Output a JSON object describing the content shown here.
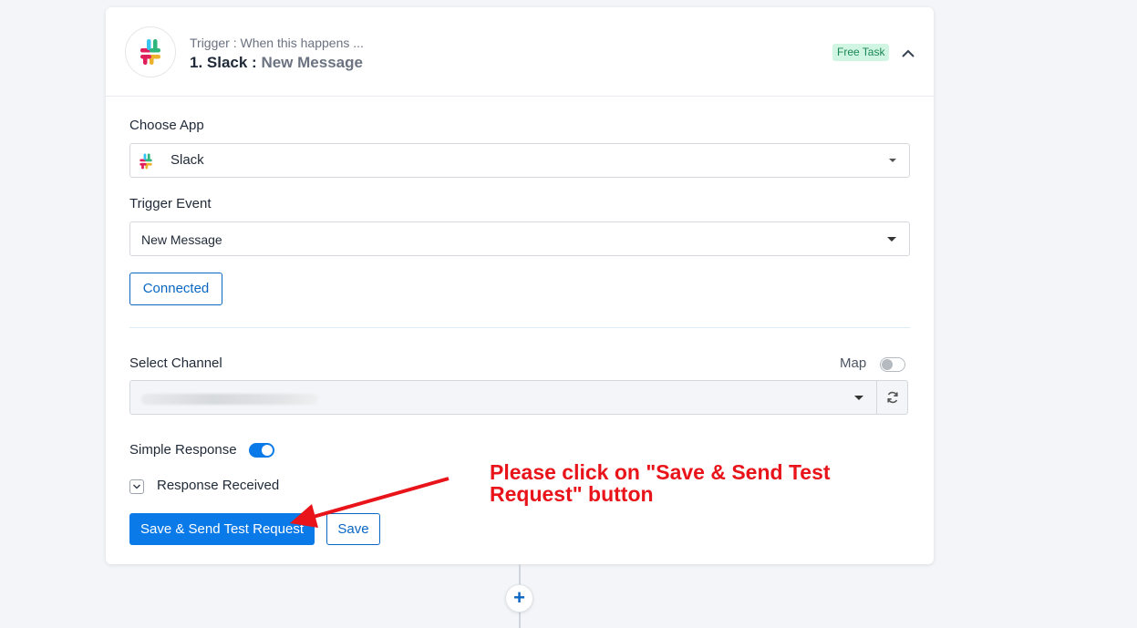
{
  "header": {
    "trigger_subtitle": "Trigger : When this happens ...",
    "step_prefix": "1. Slack :",
    "step_event": "New Message",
    "badge": "Free Task",
    "collapse_icon": "chevron-up-icon",
    "app_icon": "slack-logo-icon"
  },
  "form": {
    "choose_app_label": "Choose App",
    "choose_app_value": "Slack",
    "trigger_event_label": "Trigger Event",
    "trigger_event_value": "New Message",
    "connected_label": "Connected",
    "select_channel_label": "Select Channel",
    "map_label": "Map",
    "map_enabled": false,
    "refresh_icon": "refresh-icon",
    "simple_response_label": "Simple Response",
    "simple_response_enabled": true,
    "response_received_label": "Response Received",
    "save_send_label": "Save & Send Test Request",
    "save_label": "Save"
  },
  "annotation": {
    "text": "Please click on \"Save & Send Test Request\" button",
    "color": "#e8141a"
  },
  "colors": {
    "primary": "#0a7ae8",
    "badge_bg": "#d1f5e3",
    "badge_text": "#198754"
  },
  "add_step_icon": "plus-icon"
}
